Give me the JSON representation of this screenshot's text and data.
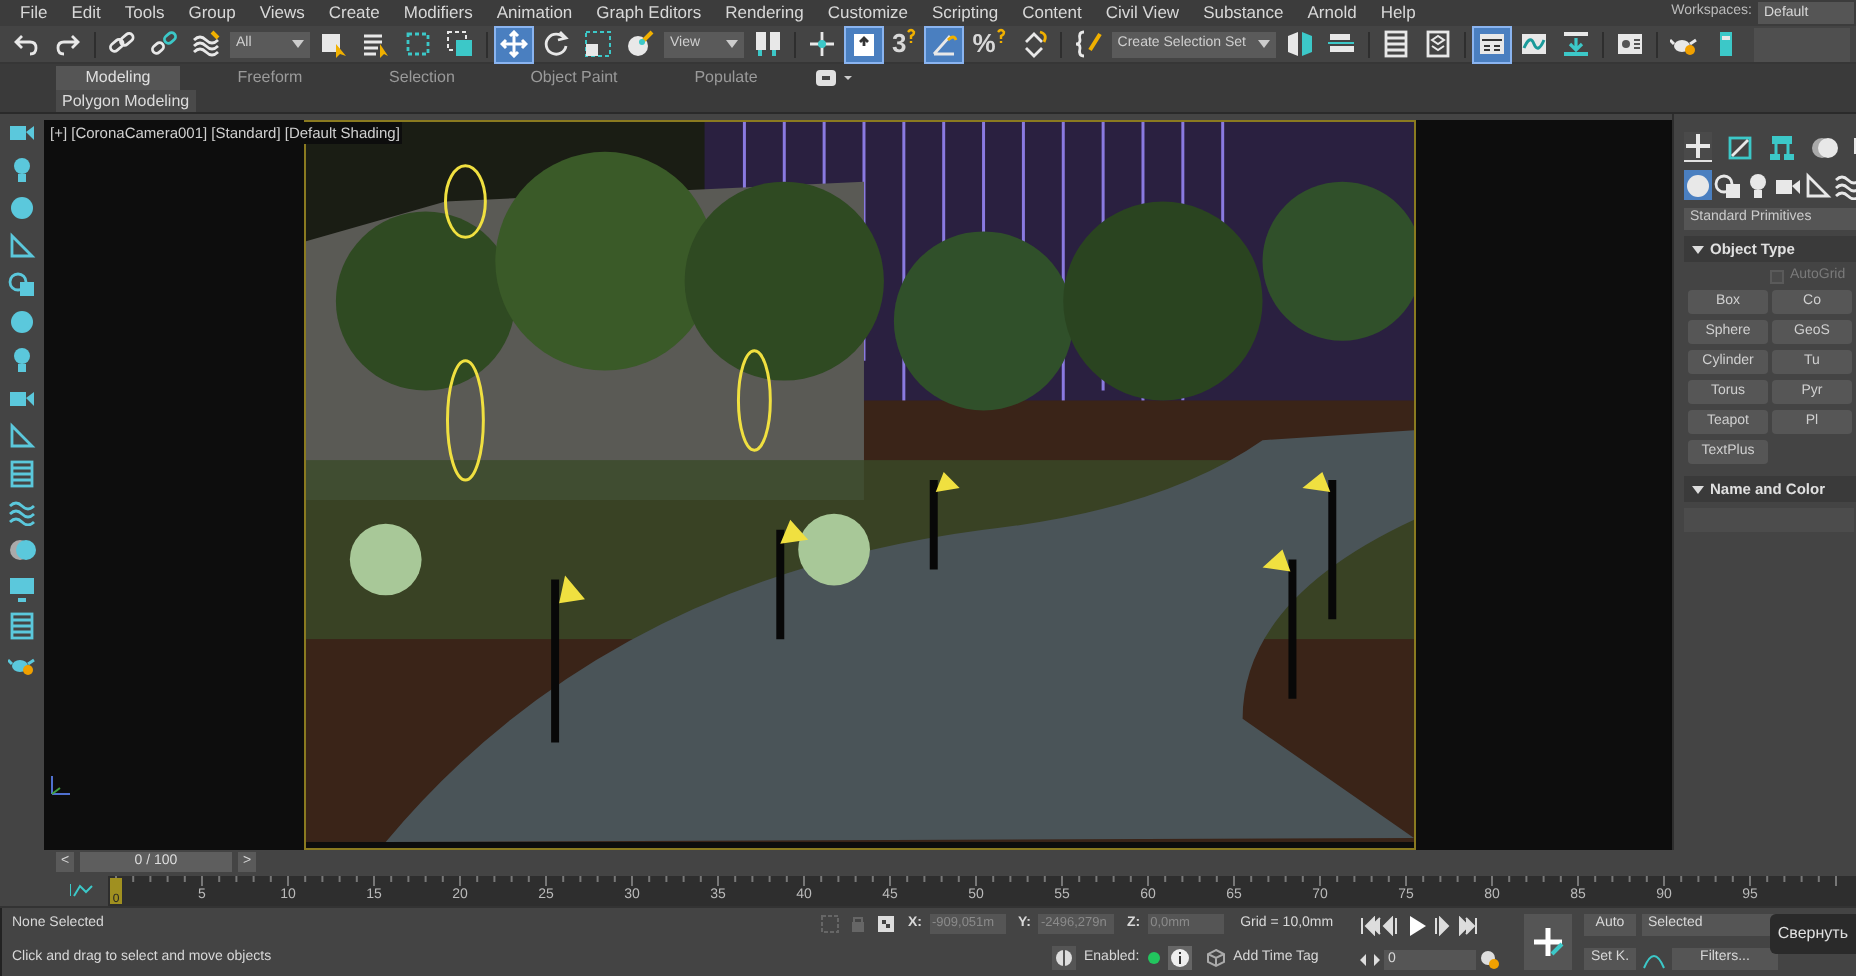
{
  "menu_bar": {
    "items": [
      "File",
      "Edit",
      "Tools",
      "Group",
      "Views",
      "Create",
      "Modifiers",
      "Animation",
      "Graph Editors",
      "Rendering",
      "Customize",
      "Scripting",
      "Content",
      "Civil View",
      "Substance",
      "Arnold",
      "Help"
    ],
    "workspaces_label": "Workspaces:",
    "workspace": "Default"
  },
  "toolbar": {
    "items": [
      {
        "kind": "undo",
        "active": false
      },
      {
        "kind": "redo",
        "active": false
      },
      {
        "kind": "sep"
      },
      {
        "kind": "link",
        "active": false
      },
      {
        "kind": "unlink",
        "active": false
      },
      {
        "kind": "bind",
        "active": false
      },
      {
        "kind": "dropdown",
        "value": "All"
      },
      {
        "kind": "select",
        "active": false
      },
      {
        "kind": "select-list",
        "active": false
      },
      {
        "kind": "region",
        "active": false
      },
      {
        "kind": "crossing",
        "active": false
      },
      {
        "kind": "sep"
      },
      {
        "kind": "move",
        "active": true
      },
      {
        "kind": "rotate",
        "active": false
      },
      {
        "kind": "scale",
        "active": false
      },
      {
        "kind": "place",
        "active": false
      },
      {
        "kind": "dropdown",
        "value": "View"
      },
      {
        "kind": "pivot",
        "active": false
      },
      {
        "kind": "sep"
      },
      {
        "kind": "manipulate",
        "active": false
      },
      {
        "kind": "keyboard",
        "active": true
      },
      {
        "kind": "snap",
        "label": "3",
        "active": false
      },
      {
        "kind": "angle",
        "active": true
      },
      {
        "kind": "snap",
        "label": "%",
        "active": false
      },
      {
        "kind": "spinner",
        "active": false
      },
      {
        "kind": "sep"
      },
      {
        "kind": "named",
        "active": false
      },
      {
        "kind": "dropdown",
        "value": "Create Selection Set"
      },
      {
        "kind": "mirror",
        "active": false
      },
      {
        "kind": "align",
        "active": false
      },
      {
        "kind": "sep"
      },
      {
        "kind": "list",
        "active": false
      },
      {
        "kind": "layers",
        "active": false
      },
      {
        "kind": "sep"
      },
      {
        "kind": "toolbox",
        "active": true
      },
      {
        "kind": "curve",
        "active": false
      },
      {
        "kind": "dope",
        "active": false
      },
      {
        "kind": "sep"
      },
      {
        "kind": "material",
        "active": false
      },
      {
        "kind": "sep"
      },
      {
        "kind": "teapot",
        "active": false
      },
      {
        "kind": "frame",
        "active": false
      }
    ]
  },
  "ribbon": {
    "tabs": [
      {
        "label": "Modeling",
        "selected": true
      },
      {
        "label": "Freeform",
        "selected": false
      },
      {
        "label": "Selection",
        "selected": false
      },
      {
        "label": "Object Paint",
        "selected": false
      },
      {
        "label": "Populate",
        "selected": false
      }
    ],
    "panel_label": "Polygon Modeling"
  },
  "viewport": {
    "label": "[+] [CoronaCamera001] [Standard] [Default Shading]"
  },
  "command_panel": {
    "tabs": [
      {
        "kind": "create",
        "selected": true
      },
      {
        "kind": "modify",
        "selected": false
      },
      {
        "kind": "hierarchy",
        "selected": false
      },
      {
        "kind": "motion",
        "selected": false
      },
      {
        "kind": "display",
        "selected": false
      }
    ],
    "categories": [
      {
        "kind": "geometry",
        "selected": true
      },
      {
        "kind": "shapes",
        "selected": false
      },
      {
        "kind": "lights",
        "selected": false
      },
      {
        "kind": "cameras",
        "selected": false
      },
      {
        "kind": "helpers",
        "selected": false
      },
      {
        "kind": "warps",
        "selected": false
      }
    ],
    "type": "Standard Primitives",
    "object_type": {
      "title": "Object Type",
      "expanded": true,
      "autogrid": {
        "label": "AutoGrid",
        "checked": false
      },
      "buttons": [
        "Box",
        "Co",
        "Sphere",
        "GeoS",
        "Cylinder",
        "Tu",
        "Torus",
        "Pyr",
        "Teapot",
        "Pl",
        "TextPlus"
      ]
    },
    "name_and_color": {
      "title": "Name and Color",
      "expanded": true
    }
  },
  "time_slider": {
    "prev": "<",
    "position": "0 / 100",
    "next": ">"
  },
  "track_bar": {
    "current": "0",
    "labels": [
      "5",
      "10",
      "15",
      "20",
      "25",
      "30",
      "35",
      "40",
      "45",
      "50",
      "55",
      "60",
      "65",
      "70",
      "75",
      "80",
      "85",
      "90",
      "95"
    ]
  },
  "status": {
    "selection": "None Selected",
    "prompt": "Click and drag to select and move objects",
    "x_label": "X:",
    "x": "-909,051m",
    "y_label": "Y:",
    "y": "-2496,279n",
    "z_label": "Z:",
    "z": "0,0mm",
    "grid": "Grid = 10,0mm",
    "enabled_label": "Enabled:",
    "enabled": true,
    "add_time_tag": "Add Time Tag",
    "frame": "0",
    "auto": "Auto",
    "key_filter": "Selected",
    "set_key": "Set K.",
    "filters": "Filters...",
    "tooltip": "Свернуть"
  }
}
